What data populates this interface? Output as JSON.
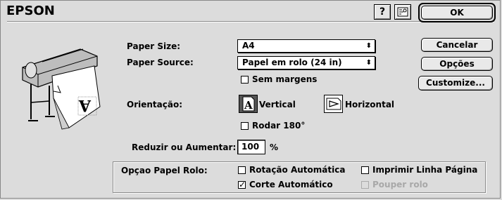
{
  "window": {
    "brand": "EPSON"
  },
  "toolbar": {
    "help_glyph": "?",
    "tool_glyph": "⌘"
  },
  "buttons": {
    "ok": "OK",
    "cancel": "Cancelar",
    "options": "Opções",
    "customize": "Customize..."
  },
  "paper": {
    "size_label": "Paper Size:",
    "size_value": "A4",
    "source_label": "Paper Source:",
    "source_value": "Papel em rolo (24 in)",
    "borderless_label": "Sem margens",
    "borderless_checked": false
  },
  "orientation": {
    "label": "Orientação:",
    "vertical_label": "Vertical",
    "horizontal_label": "Horizontal",
    "selected": "vertical",
    "rotate_label": "Rodar 180°",
    "rotate_checked": false
  },
  "scale": {
    "label": "Reduzir ou Aumentar:",
    "value": "100",
    "unit": "%"
  },
  "roll": {
    "label": "Opçao Papel Rolo:",
    "auto_rotate_label": "Rotação Automática",
    "auto_rotate_checked": false,
    "print_page_line_label": "Imprimir Linha Página",
    "print_page_line_checked": false,
    "auto_cut_label": "Corte Automático",
    "auto_cut_checked": true,
    "save_roll_label": "Pouper rolo",
    "save_roll_enabled": false
  },
  "icons": {
    "help": "help-icon",
    "tool": "settings-icon",
    "printer": "printer-illustration",
    "vertical": "portrait-orientation-icon",
    "horizontal": "landscape-orientation-icon",
    "popup_arrows": "updown-arrows-icon",
    "check": "checkmark-icon"
  }
}
